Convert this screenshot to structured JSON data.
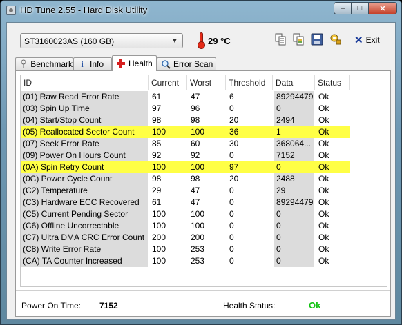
{
  "window": {
    "title": "HD Tune 2.55 - Hard Disk Utility",
    "minimize_glyph": "–",
    "maximize_glyph": "□",
    "close_glyph": "✕"
  },
  "toolbar": {
    "drive": "ST3160023AS (160 GB)",
    "temperature": "29 °C",
    "exit_label": "Exit",
    "icons": [
      "copy-text-icon",
      "copy-info-icon",
      "save-icon",
      "options-icon",
      "exit-icon"
    ]
  },
  "tabs": [
    {
      "label": "Benchmark",
      "icon": "benchmark-icon",
      "active": false
    },
    {
      "label": "Info",
      "icon": "info-icon",
      "active": false
    },
    {
      "label": "Health",
      "icon": "health-cross-icon",
      "active": true
    },
    {
      "label": "Error Scan",
      "icon": "magnifier-icon",
      "active": false
    }
  ],
  "table": {
    "columns": [
      "ID",
      "Current",
      "Worst",
      "Threshold",
      "Data",
      "Status"
    ],
    "rows": [
      {
        "id": "(01) Raw Read Error Rate",
        "current": "61",
        "worst": "47",
        "threshold": "6",
        "data": "89294479",
        "status": "Ok",
        "highlight": false
      },
      {
        "id": "(03) Spin Up Time",
        "current": "97",
        "worst": "96",
        "threshold": "0",
        "data": "0",
        "status": "Ok",
        "highlight": false
      },
      {
        "id": "(04) Start/Stop Count",
        "current": "98",
        "worst": "98",
        "threshold": "20",
        "data": "2494",
        "status": "Ok",
        "highlight": false
      },
      {
        "id": "(05) Reallocated Sector Count",
        "current": "100",
        "worst": "100",
        "threshold": "36",
        "data": "1",
        "status": "Ok",
        "highlight": true
      },
      {
        "id": "(07) Seek Error Rate",
        "current": "85",
        "worst": "60",
        "threshold": "30",
        "data": "368064...",
        "status": "Ok",
        "highlight": false
      },
      {
        "id": "(09) Power On Hours Count",
        "current": "92",
        "worst": "92",
        "threshold": "0",
        "data": "7152",
        "status": "Ok",
        "highlight": false
      },
      {
        "id": "(0A) Spin Retry Count",
        "current": "100",
        "worst": "100",
        "threshold": "97",
        "data": "0",
        "status": "Ok",
        "highlight": true
      },
      {
        "id": "(0C) Power Cycle Count",
        "current": "98",
        "worst": "98",
        "threshold": "20",
        "data": "2488",
        "status": "Ok",
        "highlight": false
      },
      {
        "id": "(C2) Temperature",
        "current": "29",
        "worst": "47",
        "threshold": "0",
        "data": "29",
        "status": "Ok",
        "highlight": false
      },
      {
        "id": "(C3) Hardware ECC Recovered",
        "current": "61",
        "worst": "47",
        "threshold": "0",
        "data": "89294479",
        "status": "Ok",
        "highlight": false
      },
      {
        "id": "(C5) Current Pending Sector",
        "current": "100",
        "worst": "100",
        "threshold": "0",
        "data": "0",
        "status": "Ok",
        "highlight": false
      },
      {
        "id": "(C6) Offline Uncorrectable",
        "current": "100",
        "worst": "100",
        "threshold": "0",
        "data": "0",
        "status": "Ok",
        "highlight": false
      },
      {
        "id": "(C7) Ultra DMA CRC Error Count",
        "current": "200",
        "worst": "200",
        "threshold": "0",
        "data": "0",
        "status": "Ok",
        "highlight": false
      },
      {
        "id": "(C8) Write Error Rate",
        "current": "100",
        "worst": "253",
        "threshold": "0",
        "data": "0",
        "status": "Ok",
        "highlight": false
      },
      {
        "id": "(CA) TA Counter Increased",
        "current": "100",
        "worst": "253",
        "threshold": "0",
        "data": "0",
        "status": "Ok",
        "highlight": false
      }
    ]
  },
  "status": {
    "power_on_label": "Power On Time:",
    "power_on_value": "7152",
    "health_label": "Health Status:",
    "health_value": "Ok"
  },
  "colors": {
    "highlight_row": "#ffff45",
    "health_ok": "#12c312",
    "shaded_column": "#dcdcdc"
  }
}
